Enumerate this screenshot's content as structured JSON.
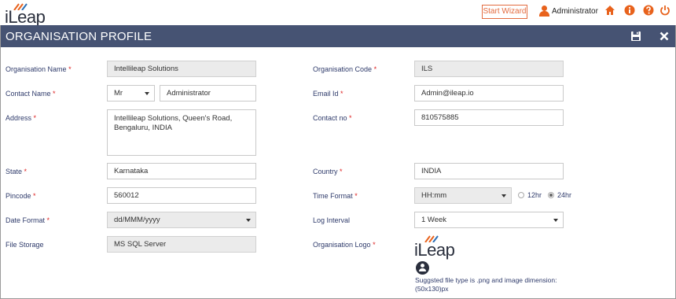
{
  "brand": {
    "logo_text": "iLeap",
    "accent": "#e8621c",
    "header_bg": "#465373",
    "label_color": "#2f3b6b"
  },
  "topbar": {
    "wizard_label": "Start Wizard",
    "user_name": "Administrator",
    "icons": [
      "user-icon",
      "home-icon",
      "info-icon",
      "help-icon",
      "power-icon"
    ]
  },
  "header": {
    "title": "ORGANISATION PROFILE",
    "icons": [
      "save-icon",
      "close-icon"
    ]
  },
  "form": {
    "org_name": {
      "label": "Organisation Name",
      "req": "*",
      "value": "Intellileap Solutions"
    },
    "org_code": {
      "label": "Organisation Code",
      "req": "*",
      "value": "ILS"
    },
    "contact_name": {
      "label": "Contact Name",
      "req": "*",
      "title_value": "Mr",
      "value": "Administrator"
    },
    "email": {
      "label": "Email Id",
      "req": "*",
      "value": "Admin@ileap.io"
    },
    "address": {
      "label": "Address",
      "req": "*",
      "value": "Intellileap Solutions, Queen's Road,\nBengaluru, INDIA"
    },
    "contact_no": {
      "label": "Contact no",
      "req": "*",
      "value": "810575885"
    },
    "state": {
      "label": "State",
      "req": "*",
      "value": "Karnataka"
    },
    "country": {
      "label": "Country",
      "req": "*",
      "value": "INDIA"
    },
    "pincode": {
      "label": "Pincode",
      "req": "*",
      "value": "560012"
    },
    "time_format": {
      "label": "Time Format",
      "req": "*",
      "value": "HH:mm",
      "option_12": "12hr",
      "option_24": "24hr",
      "selected": "24hr"
    },
    "date_format": {
      "label": "Date Format",
      "req": "*",
      "value": "dd/MMM/yyyy"
    },
    "log_interval": {
      "label": "Log Interval",
      "req": "",
      "value": "1 Week"
    },
    "file_storage": {
      "label": "File Storage",
      "req": "",
      "value": "MS SQL Server"
    },
    "org_logo": {
      "label": "Organisation Logo",
      "req": "*",
      "logo_text": "iLeap",
      "hint": "Suggsted file type is .png and image dimension: (50x130)px"
    }
  }
}
